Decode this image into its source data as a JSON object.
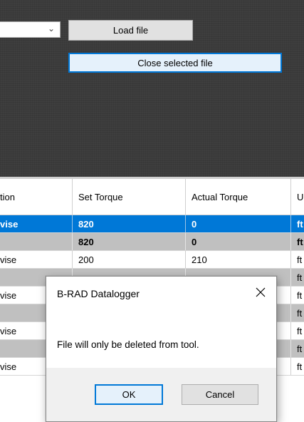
{
  "toolbar": {
    "combo_value": "",
    "load_file_label": "Load file",
    "close_selected_label": "Close selected file",
    "chevron_icon": "chevron-down-icon"
  },
  "table": {
    "headers": [
      "tion",
      "Set Torque",
      "Actual Torque",
      "U"
    ],
    "rows": [
      {
        "c1": "vise",
        "c2": "820",
        "c3": "0",
        "c4": "ft",
        "style": "sel"
      },
      {
        "c1": "",
        "c2": "820",
        "c3": "0",
        "c4": "ft",
        "style": "grey"
      },
      {
        "c1": "vise",
        "c2": "200",
        "c3": "210",
        "c4": "ft",
        "style": "white"
      },
      {
        "c1": "",
        "c2": "",
        "c3": "",
        "c4": "ft",
        "style": "grey"
      },
      {
        "c1": "vise",
        "c2": "",
        "c3": "",
        "c4": "ft",
        "style": "white"
      },
      {
        "c1": "",
        "c2": "",
        "c3": "",
        "c4": "ft",
        "style": "grey"
      },
      {
        "c1": "vise",
        "c2": "",
        "c3": "",
        "c4": "ft",
        "style": "white"
      },
      {
        "c1": "",
        "c2": "",
        "c3": "",
        "c4": "ft",
        "style": "grey"
      },
      {
        "c1": "vise",
        "c2": "",
        "c3": "",
        "c4": "ft",
        "style": "white"
      }
    ]
  },
  "dialog": {
    "title": "B-RAD Datalogger",
    "message": "File will only be deleted from tool.",
    "ok_label": "OK",
    "cancel_label": "Cancel",
    "close_icon": "close-icon"
  },
  "colors": {
    "selection": "#0078d7",
    "grey_row": "#c0c0c0",
    "panel_bg": "#3b3b3b"
  }
}
